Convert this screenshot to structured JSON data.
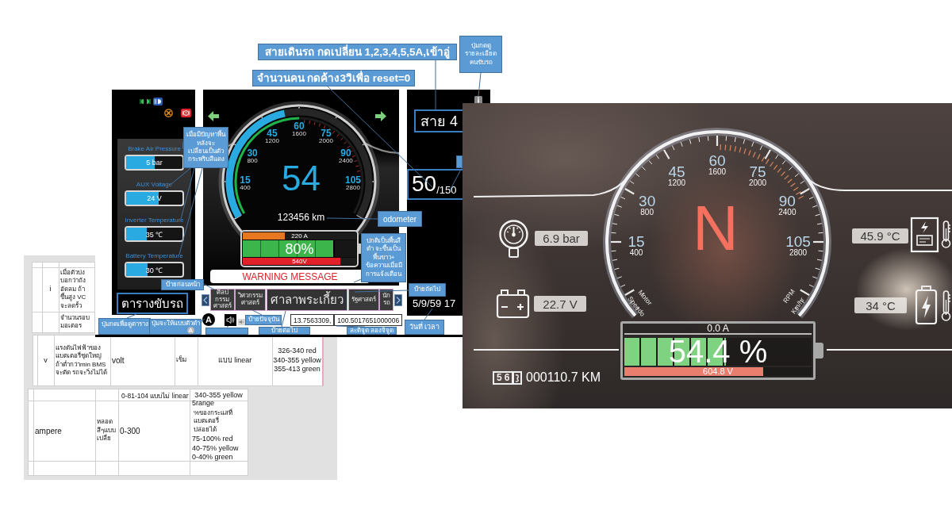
{
  "mockup": {
    "callouts": [
      {
        "kind": "title",
        "text": "สายเดินรถ กดเปลี่ยน 1,2,3,4,5,5A,เข้าอู่"
      },
      {
        "kind": "note",
        "text": "ปุ่มกดดู\nรายละเอียด\nคนขับรถ"
      },
      {
        "kind": "title",
        "text": "จำนวนคน กดค้าง3วิเพื่อ reset=0"
      },
      {
        "kind": "note",
        "text": "เมื่อมีปัญหาพื้น\nหลังจะ\nเปลี่ยนเป็นตัว\nกระพริบสีแดง"
      },
      {
        "kind": "note",
        "text": "odometer"
      },
      {
        "kind": "note",
        "text": "ปกติเป็นพื้นสี\nดำ จะขึ้นเป็น\nพื้นขาว+\nข้อความเมื่อมี\nการแจ้งเตือน"
      },
      {
        "kind": "note",
        "text": "ป้ายก่อนหน้า"
      },
      {
        "kind": "note",
        "text": "ป้ายถัดไป"
      },
      {
        "kind": "note",
        "text": "ป้ายปัจจุบัน"
      },
      {
        "kind": "note",
        "text": "ปุ่มกดเพื่อดูตาราง"
      },
      {
        "kind": "note",
        "text": "ปุ่มจะให้แบบตัวดำ",
        "badge": "A"
      },
      {
        "kind": "note",
        "text": "วันที่ เวลา"
      },
      {
        "kind": "note",
        "text": "ป้ายต่อไป"
      },
      {
        "kind": "note",
        "text": "ละติจูด ลองจิจูด"
      }
    ],
    "status_panel": {
      "gauges": [
        {
          "label": "Brake Air Pressure",
          "value": "5 bar",
          "level": 0.5
        },
        {
          "label": "AUX Voltage",
          "value": "24 V",
          "level": 0.58
        },
        {
          "label": "Inverter Temperature",
          "value": "35 ℃",
          "level": 0.36
        },
        {
          "label": "Battery Temperature",
          "value": "30 ℃",
          "level": 0.38
        }
      ],
      "schedule_button": "ตารางขับรถ"
    },
    "speedometer": {
      "speed": "54",
      "speed_arc": {
        "level": 0.45
      },
      "rpm_arc": {
        "level": 0.5
      },
      "scale": [
        {
          "speed": "15",
          "rpm": "400"
        },
        {
          "speed": "30",
          "rpm": "800"
        },
        {
          "speed": "45",
          "rpm": "1200"
        },
        {
          "speed": "60",
          "rpm": "1600"
        },
        {
          "speed": "75",
          "rpm": "2000"
        },
        {
          "speed": "90",
          "rpm": "2400"
        },
        {
          "speed": "105",
          "rpm": "2800"
        }
      ],
      "odometer": "123456 km"
    },
    "battery": {
      "current": {
        "reading": "220 A",
        "level": 0.37
      },
      "charge": {
        "reading": "80%",
        "level": 0.8
      },
      "voltage": {
        "reading": "540V",
        "level": 0.86
      }
    },
    "warning_message": "WARNING MESSAGE",
    "route_button": "สาย 4",
    "passengers": {
      "count": "50",
      "capacity": "/150"
    },
    "stops": [
      {
        "name": "ศิลป\nกรรม\nศาสตร์",
        "selected": false
      },
      {
        "name": "วิศวกรรม\nศาสตร์",
        "selected": false
      },
      {
        "name": "ศาลาพระเกี้ยว",
        "selected": true
      },
      {
        "name": "รัฐศาสตร์",
        "selected": false
      },
      {
        "name": "นัก\nรถ",
        "selected": false
      }
    ],
    "letter_button": "A",
    "coordinates": {
      "latitude": "13.7563309,",
      "longitude": "100.5017651000006"
    },
    "datetime": "5/9/59 17"
  },
  "dashboard_photo": {
    "gear": "N",
    "scale": [
      {
        "speed": "15",
        "rpm": "400"
      },
      {
        "speed": "30",
        "rpm": "800"
      },
      {
        "speed": "45",
        "rpm": "1200"
      },
      {
        "speed": "60",
        "rpm": "1600"
      },
      {
        "speed": "75",
        "rpm": "2000"
      },
      {
        "speed": "90",
        "rpm": "2400"
      },
      {
        "speed": "105",
        "rpm": "2800"
      }
    ],
    "dial_labels": [
      "Motor",
      "Speedo",
      "RPM",
      "Km/hr"
    ],
    "readings": [
      {
        "kind": "pressure",
        "value": "6.9 bar"
      },
      {
        "kind": "battery-voltage",
        "value": "22.7 V"
      },
      {
        "kind": "inverter-temperature",
        "value": "45.9 °C"
      },
      {
        "kind": "battery-temperature",
        "value": "34 °C"
      }
    ],
    "battery": {
      "current": "0.0 A",
      "percent": "54.4 %",
      "charge": {
        "level": 0.544
      },
      "voltage": {
        "reading": "604.8 V",
        "level": 0.74
      }
    },
    "odometer": {
      "digits": "56",
      "reading": "000110.7 KM"
    }
  },
  "spec_document": {
    "upper_table": {
      "marker": "i",
      "description": "เมื่อตัวบ่งบอกว่าถัง อัดลม ถ้าขึ้นสูง VC จะลดรั้ว",
      "next_row": "จำนวนรอบมอเตอร"
    },
    "middle_row": {
      "symbol": "v",
      "description": "แรงดันไฟฟ้าของแบตเตอรี่ชุดใหญ่\nถ้าต่ำกว่าmin BMS\nจะตัด รถจะวิ่งไม่ได้",
      "unit": "volt",
      "display": "เข็ม",
      "scale": "แบบ linear",
      "colors": "326-340 red\n340-355 yellow\n355-413 green"
    },
    "lower_table": {
      "scale": "0-81-104 แบบไม่ linear",
      "colors": "340-355 yellow",
      "unit": "ampere",
      "display": "หลอดสีๆแบบเปลี่ย",
      "range": "0-300",
      "range_count": "5range",
      "note": "%ของกระแสที่แบตเตอรี่\nปล่อยได้",
      "bands": "75-100% red\n40-75% yellow\n0-40% green"
    }
  }
}
